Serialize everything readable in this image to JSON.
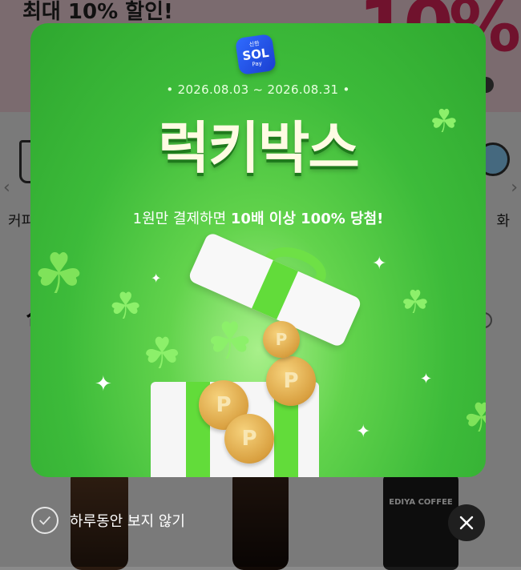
{
  "background": {
    "banner_text": "최대 10% 할인!",
    "banner_percent": "10%",
    "category_left": "커피",
    "category_right": "화",
    "section_mark": "신",
    "product3_label": "EDIYA COFFEE"
  },
  "popup": {
    "logo_top": "신한",
    "logo_main": "SOL",
    "logo_bottom": "Pay",
    "period": "• 2026.08.03 ~ 2026.08.31 •",
    "title": "럭키박스",
    "subtitle_prefix": "1원만 결제하면 ",
    "subtitle_bold": "10배 이상 100% 당첨!",
    "coin_symbol": "P"
  },
  "footer": {
    "hide_today_label": "하루동안 보지 않기"
  },
  "colors": {
    "popup_green": "#3dbb3a",
    "stripe_green": "#62dc3a",
    "logo_blue": "#2f6bff"
  }
}
